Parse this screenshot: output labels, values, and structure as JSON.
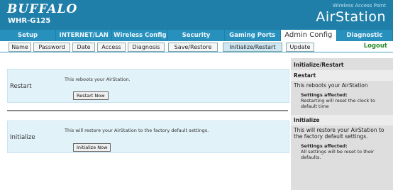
{
  "header": {
    "logo": "BUFFALO",
    "model": "WHR-G125",
    "wap_label": "Wireless Access Point",
    "product": "AirStation"
  },
  "main_tabs": [
    "Setup",
    "INTERNET/LAN",
    "Wireless Config",
    "Security",
    "Gaming Ports",
    "Admin Config",
    "Diagnostic"
  ],
  "active_main_tab": "Admin Config",
  "sub_tabs": [
    "Name",
    "Password",
    "Date",
    "Access",
    "Diagnosis",
    "Save/Restore",
    "Initialize/Restart",
    "Update"
  ],
  "active_sub_tab": "Initialize/Restart",
  "logout": "Logout",
  "restart": {
    "label": "Restart",
    "description": "This reboots your AirStation.",
    "button": "Restart Now"
  },
  "initialize": {
    "label": "Initialize",
    "description": "This will restore your AirStation to the factory default settings.",
    "button": "Initialize Now"
  },
  "help": {
    "title": "Initialize/Restart",
    "restart_title": "Restart",
    "restart_text": "This reboots your AirStation",
    "restart_affected_label": "Settings affected:",
    "restart_affected_text": "Restarting will reset the clock to default time",
    "initialize_title": "Initialize",
    "initialize_text": "This will restore your AirStation to the factory default settings.",
    "initialize_affected_label": "Settings affected:",
    "initialize_affected_text": "All settings will be reset to their defaults."
  }
}
